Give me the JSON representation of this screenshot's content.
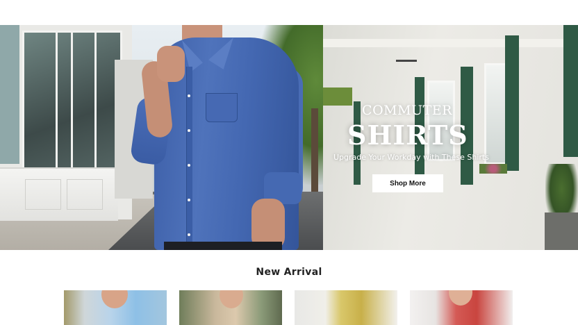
{
  "hero": {
    "title_line1": "COMMUTER",
    "title_line2": "SHIRTS",
    "subtitle": "Upgrade Your Workday with These Shirts",
    "cta_label": "Shop More"
  },
  "new_arrival": {
    "title": "New Arrival",
    "products": [
      {
        "image": "floral-blouse-photo"
      },
      {
        "image": "green-print-top-photo"
      },
      {
        "image": "yellow-accessory-photo"
      },
      {
        "image": "red-floral-dress-photo"
      }
    ]
  },
  "colors": {
    "hero_text": "#ffffff",
    "cta_background": "#ffffff",
    "cta_text": "#111111",
    "shirt_blue": "#4468b2"
  }
}
